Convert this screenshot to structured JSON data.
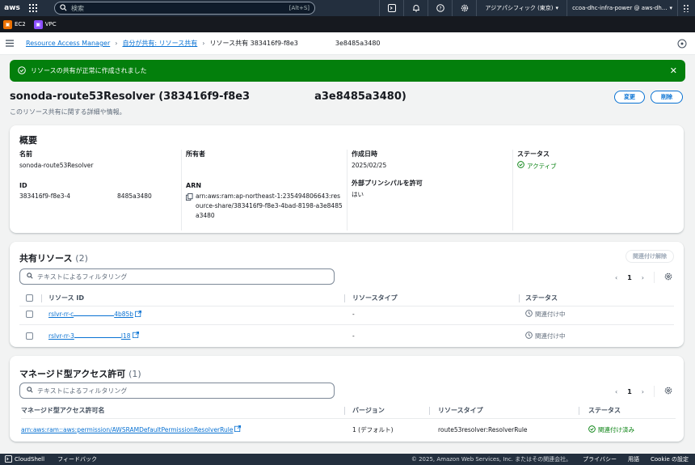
{
  "topnav": {
    "logo_text": "aws",
    "search_placeholder": "検索",
    "search_shortcut": "[Alt+S]",
    "region": "アジアパシフィック (東京)",
    "account": "ccoa-dhc-infra-power @ aws-dh..."
  },
  "services": [
    {
      "label": "EC2",
      "color": "#ed7100"
    },
    {
      "label": "VPC",
      "color": "#8c4fff"
    }
  ],
  "breadcrumb": {
    "items": [
      "Resource Access Manager",
      "自分が共有: リソース共有"
    ],
    "current": "リソース共有 383416f9-f8e3",
    "current_tail": "3e8485a3480"
  },
  "flash": {
    "message": "リソースの共有が正常に作成されました"
  },
  "header": {
    "title": "sonoda-route53Resolver (383416f9-f8e3",
    "title_tail": "a3e8485a3480)",
    "description": "このリソース共有に関する詳細や情報。",
    "edit_label": "変更",
    "delete_label": "削除"
  },
  "summary": {
    "heading": "概要",
    "name_label": "名前",
    "name_value": "sonoda-route53Resolver",
    "id_label": "ID",
    "id_value": "383416f9-f8e3-4",
    "id_value_tail": "8485a3480",
    "owner_label": "所有者",
    "arn_label": "ARN",
    "arn_value": "arn:aws:ram:ap-northeast-1:235494806643:resource-share/383416f9-f8e3-4bad-8198-a3e8485a3480",
    "created_label": "作成日時",
    "created_value": "2025/02/25",
    "external_label": "外部プリンシパルを許可",
    "external_value": "はい",
    "status_label": "ステータス",
    "status_value": "アクティブ"
  },
  "shared_resources": {
    "heading": "共有リソース",
    "count": "(2)",
    "detach_label": "関連付け解除",
    "filter_placeholder": "テキストによるフィルタリング",
    "page": "1",
    "columns": [
      "リソース ID",
      "リソースタイプ",
      "ステータス"
    ],
    "rows": [
      {
        "id": "rslvr-rr-c",
        "id_tail": "4b85b",
        "type": "-",
        "status": "関連付け中"
      },
      {
        "id": "rslvr-rr-3",
        "id_tail": "l18",
        "type": "-",
        "status": "関連付け中"
      }
    ]
  },
  "managed_permissions": {
    "heading": "マネージド型アクセス許可",
    "count": "(1)",
    "filter_placeholder": "テキストによるフィルタリング",
    "page": "1",
    "columns": [
      "マネージド型アクセス許可名",
      "バージョン",
      "リソースタイプ",
      "ステータス"
    ],
    "rows": [
      {
        "name": "arn:aws:ram::aws:permission/AWSRAMDefaultPermissionResolverRule",
        "version": "1 (デフォルト)",
        "type": "route53resolver:ResolverRule",
        "status": "関連付け済み"
      }
    ]
  },
  "footer": {
    "cloudshell": "CloudShell",
    "feedback": "フィードバック",
    "copyright": "© 2025, Amazon Web Services, Inc. またはその関連会社。",
    "privacy": "プライバシー",
    "terms": "用語",
    "cookie": "Cookie の設定"
  }
}
